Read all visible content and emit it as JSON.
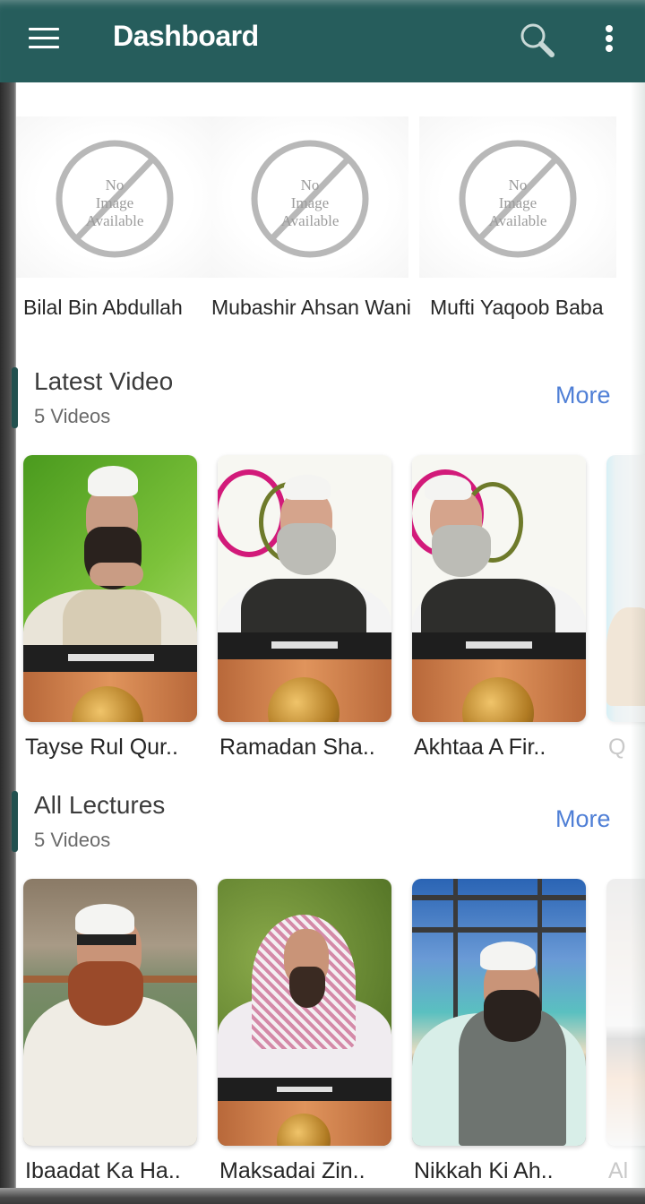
{
  "appbar": {
    "title": "Dashboard",
    "icons": [
      "menu-icon",
      "search-icon",
      "more-vert-icon"
    ],
    "color": "#265d5c"
  },
  "scholars": {
    "placeholder_text": [
      "No",
      "Image",
      "Available"
    ],
    "items": [
      {
        "name": "Bilal Bin Abdullah"
      },
      {
        "name": "Mubashir Ahsan Wani"
      },
      {
        "name": "Mufti Yaqoob Baba"
      }
    ]
  },
  "sections": [
    {
      "title": "Latest Video",
      "count": "5 Videos",
      "more_label": "More",
      "videos": [
        {
          "title": "Tayse Rul Qur.."
        },
        {
          "title": "Ramadan Sha.."
        },
        {
          "title": "Akhtaa A Fir.."
        },
        {
          "title": "Q"
        }
      ]
    },
    {
      "title": "All Lectures",
      "count": "5 Videos",
      "more_label": "More",
      "videos": [
        {
          "title": "Ibaadat Ka Ha.."
        },
        {
          "title": "Maksadai Zin.."
        },
        {
          "title": "Nikkah Ki Ah.."
        },
        {
          "title": "Al"
        }
      ]
    }
  ],
  "colors": {
    "accent_bar": "#22504f",
    "more_link": "#4f7fd6"
  }
}
